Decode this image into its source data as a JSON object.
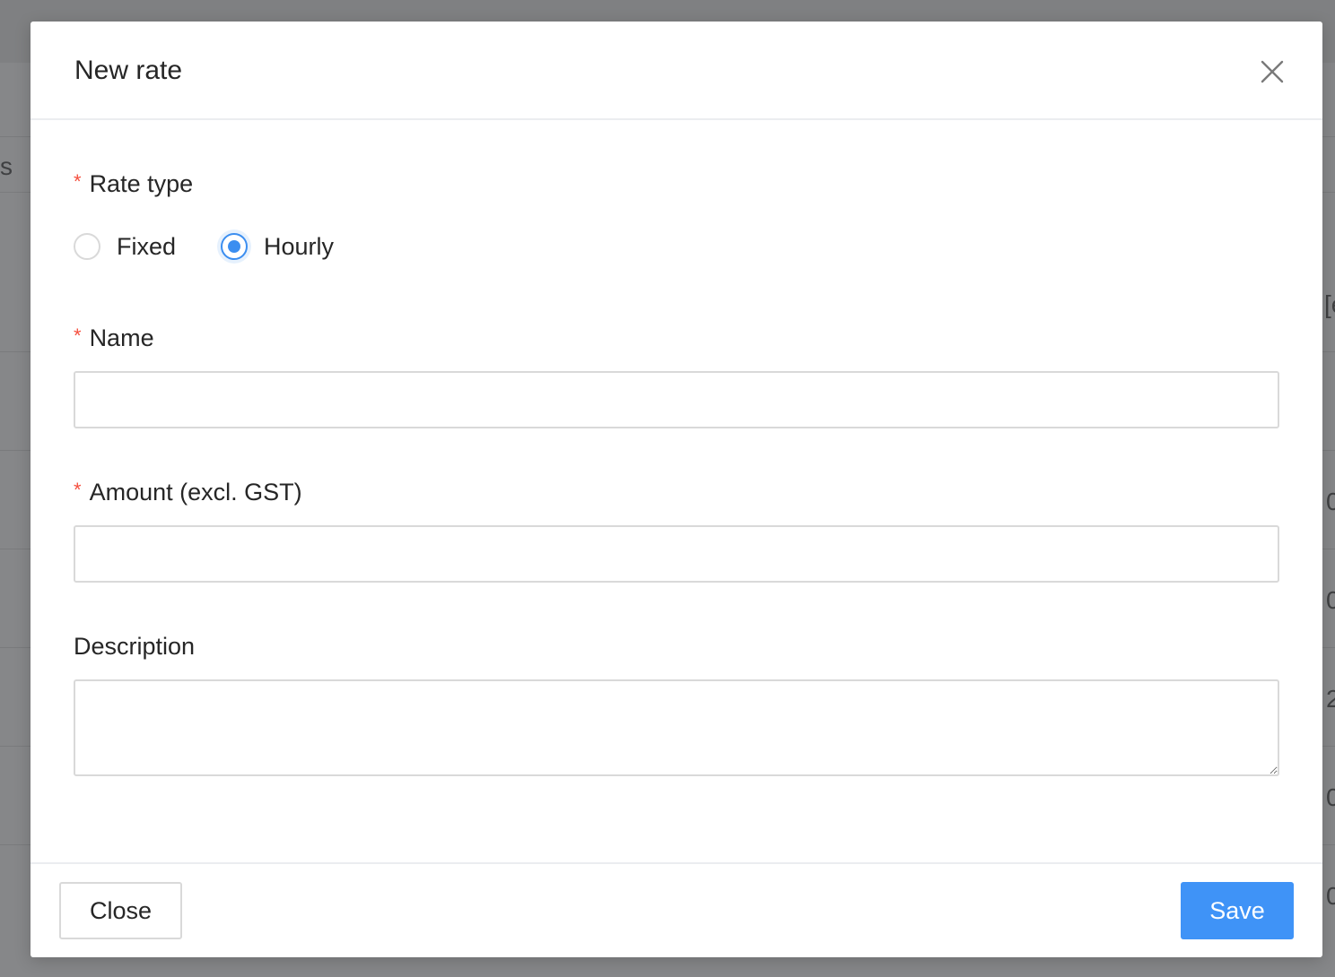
{
  "background": {
    "fragments": [
      "s",
      "[e",
      "0",
      "0",
      "2",
      "0",
      "0"
    ]
  },
  "modal": {
    "title": "New rate",
    "close_icon": "close-icon",
    "rate_type": {
      "label": "Rate type",
      "required_marker": "*",
      "options": [
        {
          "label": "Fixed",
          "checked": false
        },
        {
          "label": "Hourly",
          "checked": true
        }
      ]
    },
    "name": {
      "label": "Name",
      "required_marker": "*",
      "value": "",
      "placeholder": ""
    },
    "amount": {
      "label": "Amount (excl. GST)",
      "required_marker": "*",
      "value": "",
      "placeholder": ""
    },
    "description": {
      "label": "Description",
      "value": "",
      "placeholder": ""
    },
    "footer": {
      "close_label": "Close",
      "save_label": "Save"
    }
  },
  "colors": {
    "accent": "#3f93f7",
    "required": "#f5503f",
    "overlay": "#868789"
  }
}
